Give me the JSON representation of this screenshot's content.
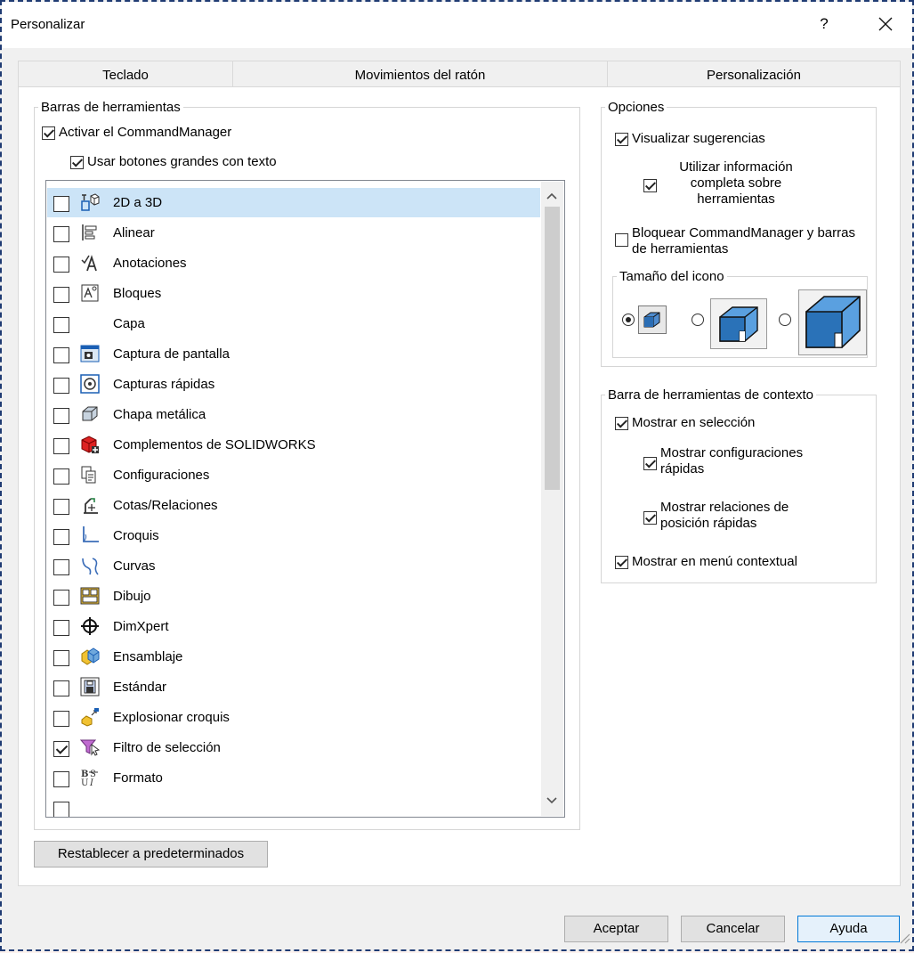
{
  "window": {
    "title": "Personalizar",
    "help_glyph": "?"
  },
  "tabs": [
    "Teclado",
    "Movimientos del ratón",
    "Personalización"
  ],
  "toolbars_group": {
    "legend": "Barras de herramientas",
    "activate_cm": {
      "label": "Activar el CommandManager",
      "checked": true
    },
    "large_buttons": {
      "label": "Usar botones grandes con texto",
      "checked": true
    },
    "items": [
      {
        "label": "2D a 3D",
        "checked": false,
        "selected": true,
        "icon": "2d-to-3d-icon"
      },
      {
        "label": "Alinear",
        "checked": false,
        "icon": "align-icon"
      },
      {
        "label": "Anotaciones",
        "checked": false,
        "icon": "annotation-icon"
      },
      {
        "label": "Bloques",
        "checked": false,
        "icon": "blocks-icon"
      },
      {
        "label": "Capa",
        "checked": false,
        "icon": ""
      },
      {
        "label": "Captura de pantalla",
        "checked": false,
        "icon": "screen-capture-icon"
      },
      {
        "label": "Capturas rápidas",
        "checked": false,
        "icon": "quick-snaps-icon"
      },
      {
        "label": "Chapa metálica",
        "checked": false,
        "icon": "sheet-metal-icon"
      },
      {
        "label": "Complementos de SOLIDWORKS",
        "checked": false,
        "icon": "addins-icon"
      },
      {
        "label": "Configuraciones",
        "checked": false,
        "icon": "configurations-icon"
      },
      {
        "label": "Cotas/Relaciones",
        "checked": false,
        "icon": "dimensions-icon"
      },
      {
        "label": "Croquis",
        "checked": false,
        "icon": "sketch-icon"
      },
      {
        "label": "Curvas",
        "checked": false,
        "icon": "curves-icon"
      },
      {
        "label": "Dibujo",
        "checked": false,
        "icon": "drawing-icon"
      },
      {
        "label": "DimXpert",
        "checked": false,
        "icon": "dimxpert-icon"
      },
      {
        "label": "Ensamblaje",
        "checked": false,
        "icon": "assembly-icon"
      },
      {
        "label": "Estándar",
        "checked": false,
        "icon": "standard-icon"
      },
      {
        "label": "Explosionar croquis",
        "checked": false,
        "icon": "explode-sketch-icon"
      },
      {
        "label": "Filtro de selección",
        "checked": true,
        "icon": "selection-filter-icon"
      },
      {
        "label": "Formato",
        "checked": false,
        "icon": "format-icon"
      }
    ],
    "reset_button": "Restablecer a predeterminados"
  },
  "options_group": {
    "legend": "Opciones",
    "show_tooltips": {
      "label": "Visualizar sugerencias",
      "checked": true
    },
    "full_info": {
      "label": "Utilizar información completa sobre herramientas",
      "checked": true
    },
    "lock_cm": {
      "label": "Bloquear CommandManager y barras de herramientas",
      "checked": false
    },
    "icon_size": {
      "legend": "Tamaño del icono",
      "selected": "small",
      "options": [
        "small",
        "medium",
        "large"
      ]
    }
  },
  "context_group": {
    "legend": "Barra de herramientas de contexto",
    "show_on_selection": {
      "label": "Mostrar en selección",
      "checked": true
    },
    "quick_configs": {
      "label": "Mostrar configuraciones rápidas",
      "checked": true
    },
    "quick_mates": {
      "label": "Mostrar relaciones de posición rápidas",
      "checked": true
    },
    "show_in_menu": {
      "label": "Mostrar en menú contextual",
      "checked": true
    }
  },
  "footer": {
    "ok": "Aceptar",
    "cancel": "Cancelar",
    "help": "Ayuda"
  },
  "colors": {
    "selection": "#cce4f7",
    "accent": "#0078d7",
    "frame": "#1f3b73"
  }
}
